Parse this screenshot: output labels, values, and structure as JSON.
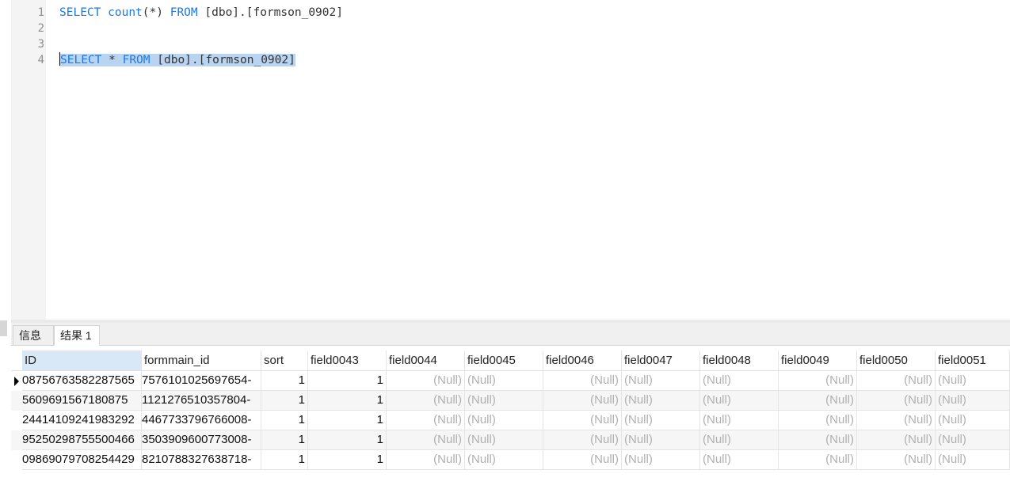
{
  "editor": {
    "line_numbers": [
      "1",
      "2",
      "3",
      "4"
    ],
    "line1": {
      "select": "SELECT",
      "count": "count",
      "paren": "(*)",
      "from": "FROM",
      "table": "[dbo].[formson_0902]"
    },
    "line4": {
      "select": "SELECT",
      "star": "*",
      "from": "FROM",
      "table": "[dbo].[formson_0902]"
    }
  },
  "tabs": {
    "info": "信息",
    "result": "结果 1"
  },
  "grid": {
    "columns": [
      "ID",
      "formmain_id",
      "sort",
      "field0043",
      "field0044",
      "field0045",
      "field0046",
      "field0047",
      "field0048",
      "field0049",
      "field0050",
      "field0051"
    ],
    "rows": [
      [
        "-8756763582287565",
        "-7576101025697654",
        "1",
        "1",
        "(Null)",
        "(Null)",
        "(Null)",
        "(Null)",
        "(Null)",
        "(Null)",
        "(Null)",
        "(Null)"
      ],
      [
        "5609691567180875",
        "1121276510357804",
        "1",
        "1",
        "(Null)",
        "(Null)",
        "(Null)",
        "(Null)",
        "(Null)",
        "(Null)",
        "(Null)",
        "(Null)"
      ],
      [
        "2441410924198329 2",
        "4467733796766008",
        "1",
        "1",
        "(Null)",
        "(Null)",
        "(Null)",
        "(Null)",
        "(Null)",
        "(Null)",
        "(Null)",
        "(Null)"
      ],
      [
        "9525029875550046 6",
        "3503909600773008",
        "1",
        "1",
        "(Null)",
        "(Null)",
        "(Null)",
        "(Null)",
        "(Null)",
        "(Null)",
        "(Null)",
        "(Null)"
      ],
      [
        "9869079708254429",
        "8210788327638718",
        "1",
        "1",
        "(Null)",
        "(Null)",
        "(Null)",
        "(Null)",
        "(Null)",
        "(Null)",
        "(Null)",
        "(Null)"
      ]
    ],
    "id_display": [
      "08756763582287565",
      "5609691567180875",
      "24414109241983292",
      "95250298755500466",
      "09869079708254429"
    ],
    "formmain_display": [
      "-7576101025697654",
      "-1121276510357804",
      "-4467733796766008",
      "-3503909600773008",
      "-8210788327638718"
    ]
  }
}
